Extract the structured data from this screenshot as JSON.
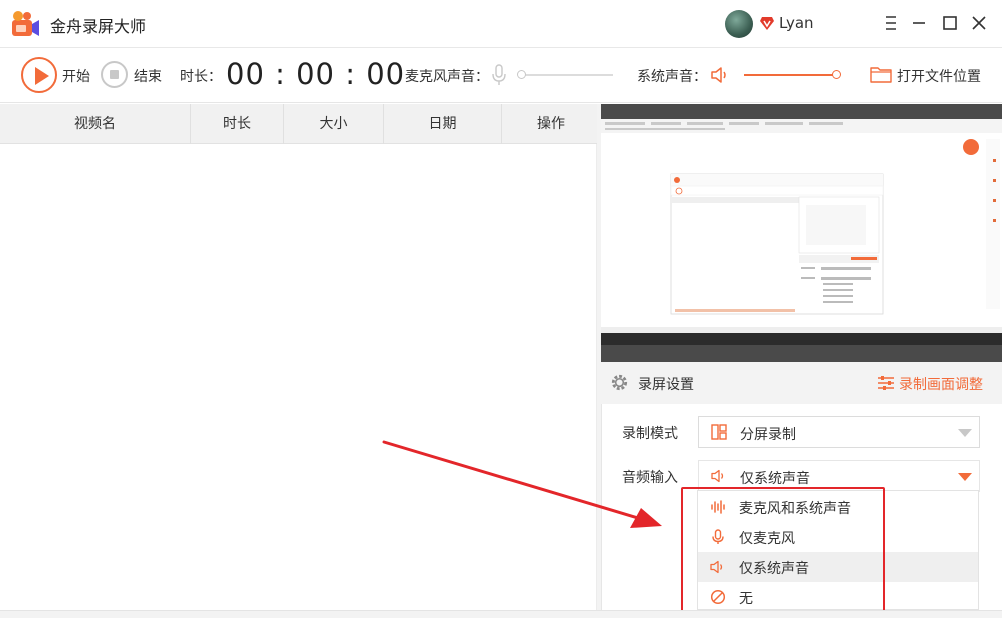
{
  "app": {
    "title": "金舟录屏大师",
    "username": "Lyan"
  },
  "toolbar": {
    "start_label": "开始",
    "stop_label": "结束",
    "duration_label": "时长：",
    "timer": "00 : 00 : 00",
    "mic_label": "麦克风声音：",
    "mic_level": 0,
    "system_label": "系统声音：",
    "system_level": 1.0,
    "open_folder_label": "打开文件位置"
  },
  "table": {
    "columns": [
      "视频名",
      "时长",
      "大小",
      "日期",
      "操作"
    ],
    "rows": []
  },
  "settings": {
    "title": "录屏设置",
    "adjust_label": "录制画面调整",
    "mode_label": "录制模式",
    "mode_value": "分屏录制",
    "audio_label": "音频输入",
    "audio_value": "仅系统声音",
    "audio_options": [
      {
        "label": "麦克风和系统声音",
        "icon": "sound-wave-icon"
      },
      {
        "label": "仅麦克风",
        "icon": "microphone-icon"
      },
      {
        "label": "仅系统声音",
        "icon": "speaker-icon"
      },
      {
        "label": "无",
        "icon": "none-icon"
      }
    ],
    "selected_option_index": 2
  },
  "colors": {
    "accent": "#f26b3a",
    "highlight_box": "#e3262a",
    "disabled": "#c8c8c8"
  }
}
